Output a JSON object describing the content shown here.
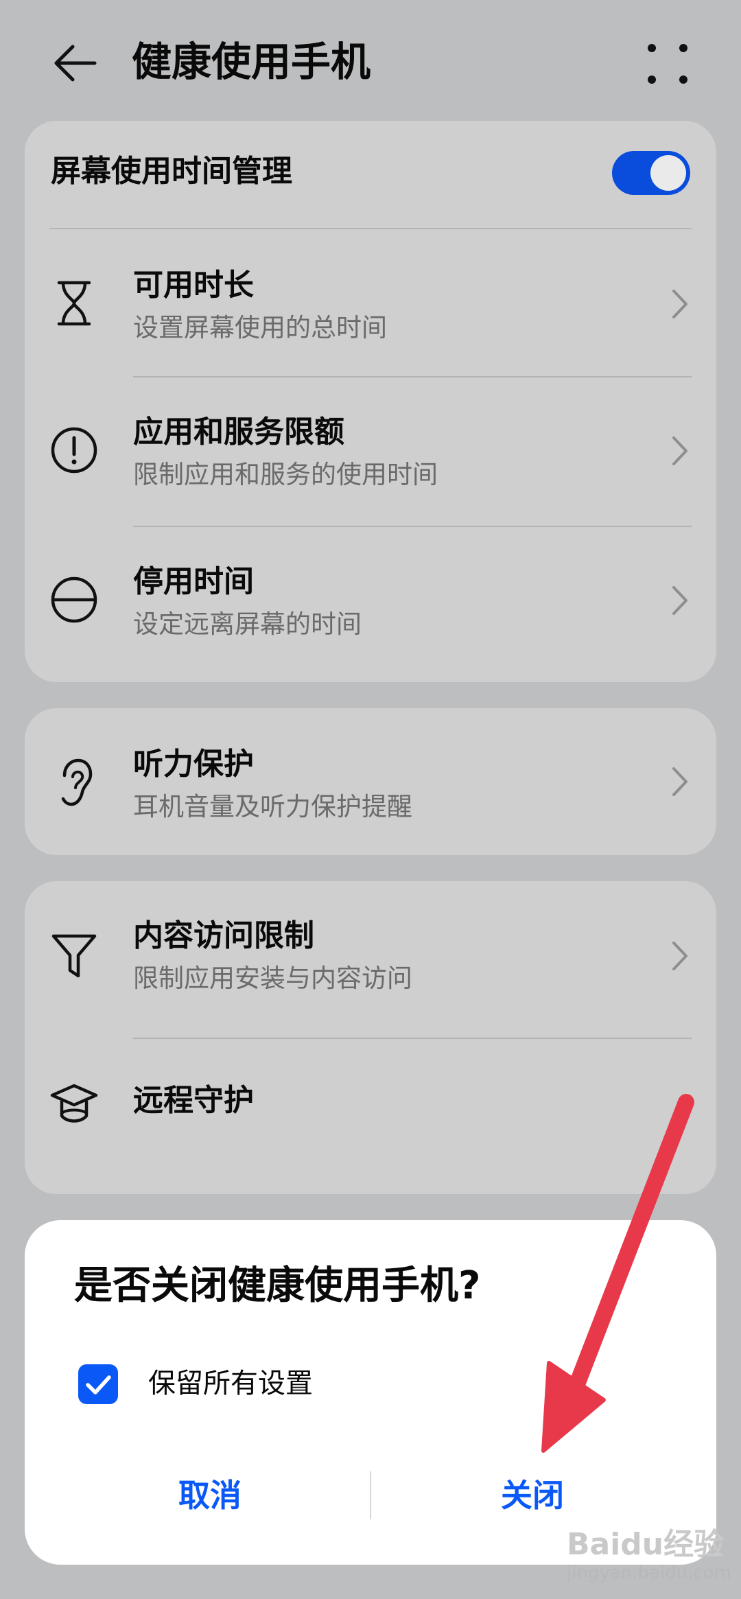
{
  "header": {
    "title": "健康使用手机"
  },
  "screen_time": {
    "label": "屏幕使用时间管理",
    "enabled": true,
    "items": [
      {
        "title": "可用时长",
        "subtitle": "设置屏幕使用的总时间"
      },
      {
        "title": "应用和服务限额",
        "subtitle": "限制应用和服务的使用时间"
      },
      {
        "title": "停用时间",
        "subtitle": "设定远离屏幕的时间"
      }
    ]
  },
  "hearing": {
    "title": "听力保护",
    "subtitle": "耳机音量及听力保护提醒"
  },
  "content": {
    "items": [
      {
        "title": "内容访问限制",
        "subtitle": "限制应用安装与内容访问"
      },
      {
        "title": "远程守护"
      }
    ]
  },
  "dialog": {
    "title": "是否关闭健康使用手机?",
    "checkbox_label": "保留所有设置",
    "checkbox_checked": true,
    "cancel_label": "取消",
    "confirm_label": "关闭"
  },
  "watermark": {
    "logo": "Baidu经验",
    "url": "jingyan.baidu.com"
  },
  "colors": {
    "accent": "#0a59f7",
    "switch_on": "#0a4cdb",
    "annotation_arrow": "#e8394a"
  }
}
